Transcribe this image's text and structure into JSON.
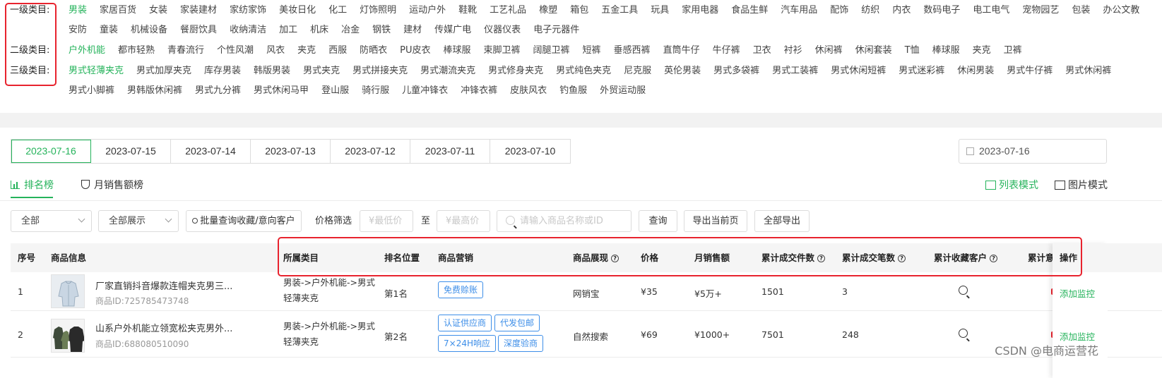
{
  "categories": {
    "level1_label": "一级类目:",
    "level1_items": [
      "男装",
      "家居百货",
      "女装",
      "家装建材",
      "家纺家饰",
      "美妆日化",
      "化工",
      "灯饰照明",
      "运动户外",
      "鞋靴",
      "工艺礼品",
      "橡塑",
      "箱包",
      "五金工具",
      "玩具",
      "家用电器",
      "食品生鲜",
      "汽车用品",
      "配饰",
      "纺织",
      "内衣",
      "数码电子",
      "电工电气",
      "宠物园艺",
      "包装",
      "办公文教",
      "安防",
      "童装",
      "机械设备",
      "餐厨饮具",
      "收纳清洁",
      "加工",
      "机床",
      "冶金",
      "钢铁",
      "建材",
      "传媒广电",
      "仪器仪表",
      "电子元器件"
    ],
    "level2_label": "二级类目:",
    "level2_items": [
      "户外机能",
      "都市轻熟",
      "青春流行",
      "个性风潮",
      "风衣",
      "夹克",
      "西服",
      "防晒衣",
      "PU皮衣",
      "棒球服",
      "束脚卫裤",
      "阔腿卫裤",
      "短裤",
      "垂感西裤",
      "直筒牛仔",
      "牛仔裤",
      "卫衣",
      "衬衫",
      "休闲裤",
      "休闲套装",
      "T恤",
      "棒球服",
      "夹克",
      "卫裤"
    ],
    "level3_label": "三级类目:",
    "level3_items": [
      "男式轻薄夹克",
      "男式加厚夹克",
      "库存男装",
      "韩版男装",
      "男式夹克",
      "男式拼接夹克",
      "男式潮流夹克",
      "男式修身夹克",
      "男式纯色夹克",
      "尼克服",
      "英伦男装",
      "男式多袋裤",
      "男式工装裤",
      "男式休闲短裤",
      "男式迷彩裤",
      "休闲男装",
      "男式牛仔裤",
      "男式休闲裤",
      "男式小脚裤",
      "男韩版休闲裤",
      "男式九分裤",
      "男式休闲马甲",
      "登山服",
      "骑行服",
      "儿童冲锋衣",
      "冲锋衣裤",
      "皮肤风衣",
      "钓鱼服",
      "外贸运动服"
    ]
  },
  "dates": [
    "2023-07-16",
    "2023-07-15",
    "2023-07-14",
    "2023-07-13",
    "2023-07-12",
    "2023-07-11",
    "2023-07-10"
  ],
  "date_picker_value": "2023-07-16",
  "rank_tabs": [
    "排名榜",
    "月销售额榜"
  ],
  "view_modes": {
    "list": "列表模式",
    "picture": "图片模式"
  },
  "filters": {
    "select_all": "全部",
    "select_display": "全部展示",
    "batch_query": "批量查询收藏/意向客户",
    "price_label": "价格筛选",
    "min_price_placeholder": "¥最低价",
    "to_label": "至",
    "max_price_placeholder": "¥最高价",
    "search_placeholder": "请输入商品名称或ID",
    "query_button": "查询",
    "export_page_button": "导出当前页",
    "export_all_button": "全部导出"
  },
  "table": {
    "headers": {
      "index": "序号",
      "product": "商品信息",
      "category": "所属类目",
      "rank": "排名位置",
      "marketing": "商品营销",
      "display": "商品展现",
      "price": "价格",
      "monthly_sales": "月销售额",
      "total_pieces": "累计成交件数",
      "total_orders": "累计成交笔数",
      "fav_customers": "累计收藏客户",
      "intent": "累计意向",
      "op": "操作"
    },
    "rows": [
      {
        "index": "1",
        "name": "厂家直销抖音爆款连帽夹克男三...",
        "id": "商品ID:725785473748",
        "category": "男装->户外机能->男式轻薄夹克",
        "rank": "第1名",
        "tags": [
          "免费赊账"
        ],
        "display": "网销宝",
        "price": "¥35",
        "monthly_sales": "¥5万+",
        "total_pieces": "1501",
        "total_orders": "3",
        "op": "添加监控"
      },
      {
        "index": "2",
        "name": "山系户外机能立领宽松夹克男外...",
        "id": "商品ID:688080510090",
        "category": "男装->户外机能->男式轻薄夹克",
        "rank": "第2名",
        "tags": [
          "认证供应商",
          "代发包邮",
          "7×24H响应",
          "深度验商"
        ],
        "display": "自然搜索",
        "price": "¥69",
        "monthly_sales": "¥1000+",
        "total_pieces": "7501",
        "total_orders": "248",
        "op": "添加监控"
      }
    ]
  },
  "watermark": "CSDN @电商运营花",
  "colors": {
    "accent": "#25b35b",
    "highlight_box": "#e8232e",
    "tag_blue": "#3d8ee8"
  }
}
